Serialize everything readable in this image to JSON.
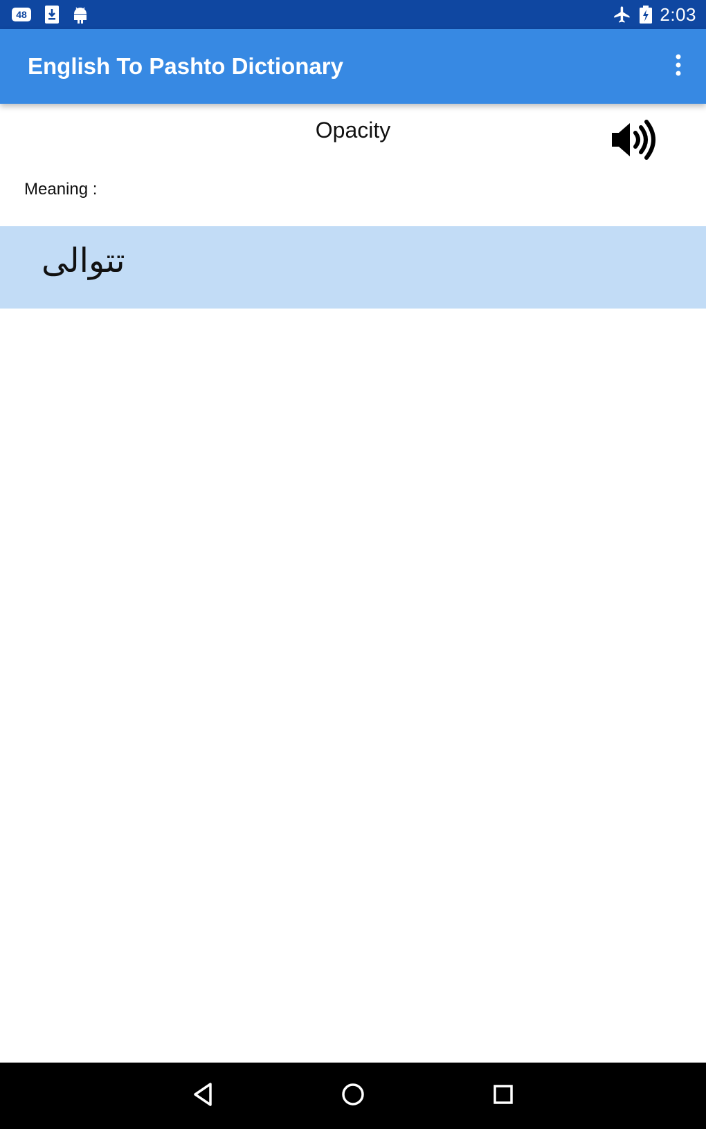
{
  "status_bar": {
    "badge_text": "48",
    "time": "2:03",
    "icons": [
      "48-badge-icon",
      "download-icon",
      "android-icon",
      "airplane-mode-icon",
      "battery-charging-icon"
    ]
  },
  "app_bar": {
    "title": "English To Pashto Dictionary",
    "menu_icon": "overflow-menu-icon"
  },
  "word": {
    "text": "Opacity",
    "speaker_icon": "speaker-icon"
  },
  "meaning": {
    "label": "Meaning :",
    "text": "تتوالی"
  },
  "nav_bar": {
    "icons": [
      "back-icon",
      "home-icon",
      "recents-icon"
    ]
  },
  "colors": {
    "status_bar": "#0f47a1",
    "app_bar": "#3789e3",
    "meaning_background": "#c2dcf6",
    "nav_bar": "#000000"
  }
}
